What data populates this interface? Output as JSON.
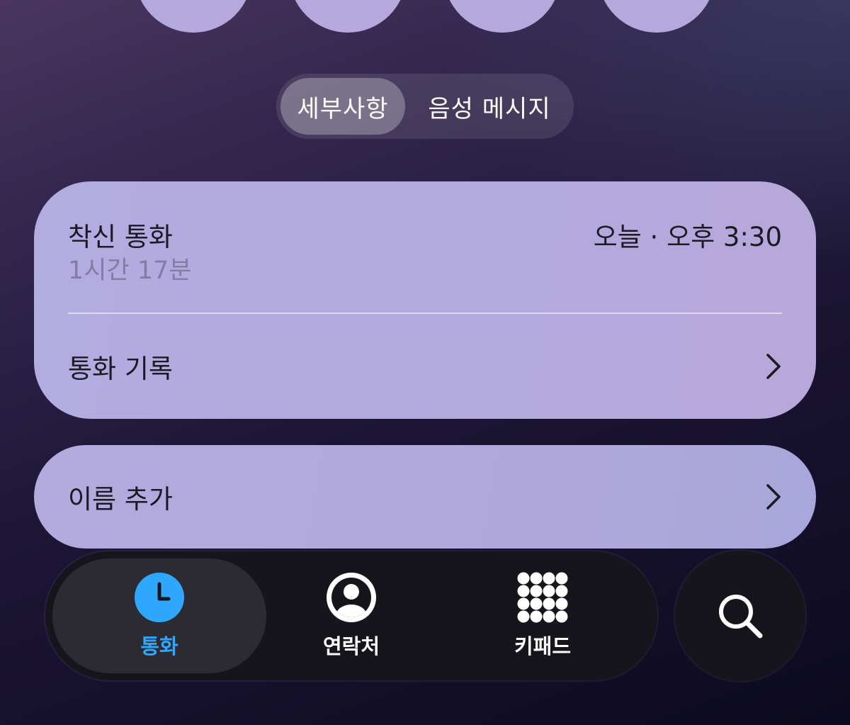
{
  "segmented_control": {
    "details_label": "세부사항",
    "voicemail_label": "음성 메시지"
  },
  "call_card": {
    "call_type": "착신 통화",
    "duration": "1시간 17분",
    "timestamp": "오늘 · 오후 3:30",
    "history_label": "통화 기록"
  },
  "add_name_card": {
    "label": "이름 추가"
  },
  "tab_bar": {
    "tabs": [
      {
        "label": "통화",
        "icon": "clock-icon",
        "active": true
      },
      {
        "label": "연락처",
        "icon": "person-circle-icon",
        "active": false
      },
      {
        "label": "키패드",
        "icon": "keypad-grid-icon",
        "active": false
      }
    ],
    "search_icon": "magnifying-glass-icon"
  },
  "colors": {
    "card_background": "#b3ace0",
    "active_tab_accent": "#2ea7ff",
    "tab_bar_background": "#16151b",
    "secondary_text": "#837ca4"
  }
}
